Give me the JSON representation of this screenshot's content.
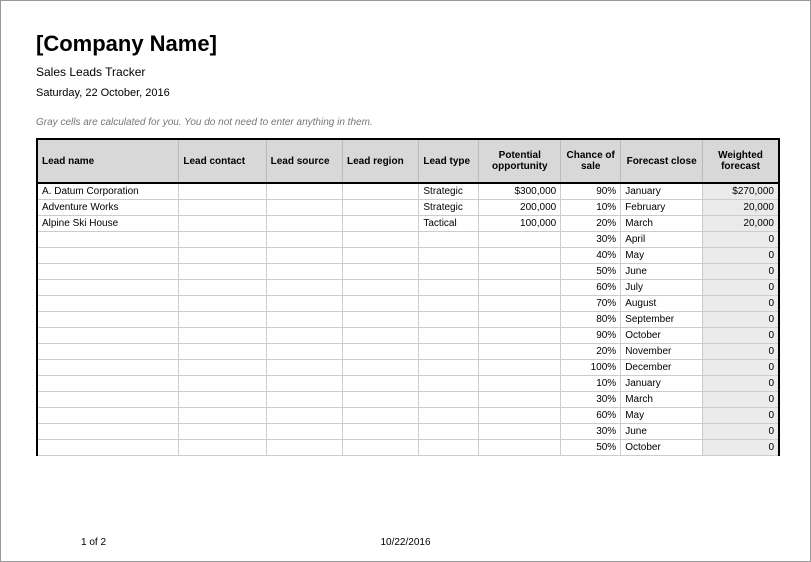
{
  "header": {
    "title": "[Company Name]",
    "subtitle": "Sales Leads Tracker",
    "date": "Saturday, 22 October, 2016",
    "note": "Gray cells are calculated for you. You do not need to enter anything in them."
  },
  "table": {
    "columns": {
      "lead_name": "Lead   name",
      "lead_contact": "Lead   contact",
      "lead_source": "Lead   source",
      "lead_region": "Lead   region",
      "lead_type": "Lead   type",
      "potential": "Potential opportunity",
      "chance": "Chance of sale",
      "forecast_close": "Forecast close",
      "weighted": "Weighted forecast"
    },
    "rows": [
      {
        "name": "A. Datum Corporation",
        "contact": "",
        "source": "",
        "region": "",
        "type": "Strategic",
        "potential": "$300,000",
        "chance": "90%",
        "close": "January",
        "weighted": "$270,000"
      },
      {
        "name": "Adventure Works",
        "contact": "",
        "source": "",
        "region": "",
        "type": "Strategic",
        "potential": "200,000",
        "chance": "10%",
        "close": "February",
        "weighted": "20,000"
      },
      {
        "name": "Alpine Ski House",
        "contact": "",
        "source": "",
        "region": "",
        "type": "Tactical",
        "potential": "100,000",
        "chance": "20%",
        "close": "March",
        "weighted": "20,000"
      },
      {
        "name": "",
        "contact": "",
        "source": "",
        "region": "",
        "type": "",
        "potential": "",
        "chance": "30%",
        "close": "April",
        "weighted": "0"
      },
      {
        "name": "",
        "contact": "",
        "source": "",
        "region": "",
        "type": "",
        "potential": "",
        "chance": "40%",
        "close": "May",
        "weighted": "0"
      },
      {
        "name": "",
        "contact": "",
        "source": "",
        "region": "",
        "type": "",
        "potential": "",
        "chance": "50%",
        "close": "June",
        "weighted": "0"
      },
      {
        "name": "",
        "contact": "",
        "source": "",
        "region": "",
        "type": "",
        "potential": "",
        "chance": "60%",
        "close": "July",
        "weighted": "0"
      },
      {
        "name": "",
        "contact": "",
        "source": "",
        "region": "",
        "type": "",
        "potential": "",
        "chance": "70%",
        "close": "August",
        "weighted": "0"
      },
      {
        "name": "",
        "contact": "",
        "source": "",
        "region": "",
        "type": "",
        "potential": "",
        "chance": "80%",
        "close": "September",
        "weighted": "0"
      },
      {
        "name": "",
        "contact": "",
        "source": "",
        "region": "",
        "type": "",
        "potential": "",
        "chance": "90%",
        "close": "October",
        "weighted": "0"
      },
      {
        "name": "",
        "contact": "",
        "source": "",
        "region": "",
        "type": "",
        "potential": "",
        "chance": "20%",
        "close": "November",
        "weighted": "0"
      },
      {
        "name": "",
        "contact": "",
        "source": "",
        "region": "",
        "type": "",
        "potential": "",
        "chance": "100%",
        "close": "December",
        "weighted": "0"
      },
      {
        "name": "",
        "contact": "",
        "source": "",
        "region": "",
        "type": "",
        "potential": "",
        "chance": "10%",
        "close": "January",
        "weighted": "0"
      },
      {
        "name": "",
        "contact": "",
        "source": "",
        "region": "",
        "type": "",
        "potential": "",
        "chance": "30%",
        "close": "March",
        "weighted": "0"
      },
      {
        "name": "",
        "contact": "",
        "source": "",
        "region": "",
        "type": "",
        "potential": "",
        "chance": "60%",
        "close": "May",
        "weighted": "0"
      },
      {
        "name": "",
        "contact": "",
        "source": "",
        "region": "",
        "type": "",
        "potential": "",
        "chance": "30%",
        "close": "June",
        "weighted": "0"
      },
      {
        "name": "",
        "contact": "",
        "source": "",
        "region": "",
        "type": "",
        "potential": "",
        "chance": "50%",
        "close": "October",
        "weighted": "0"
      }
    ]
  },
  "footer": {
    "page": "1 of 2",
    "date": "10/22/2016"
  }
}
